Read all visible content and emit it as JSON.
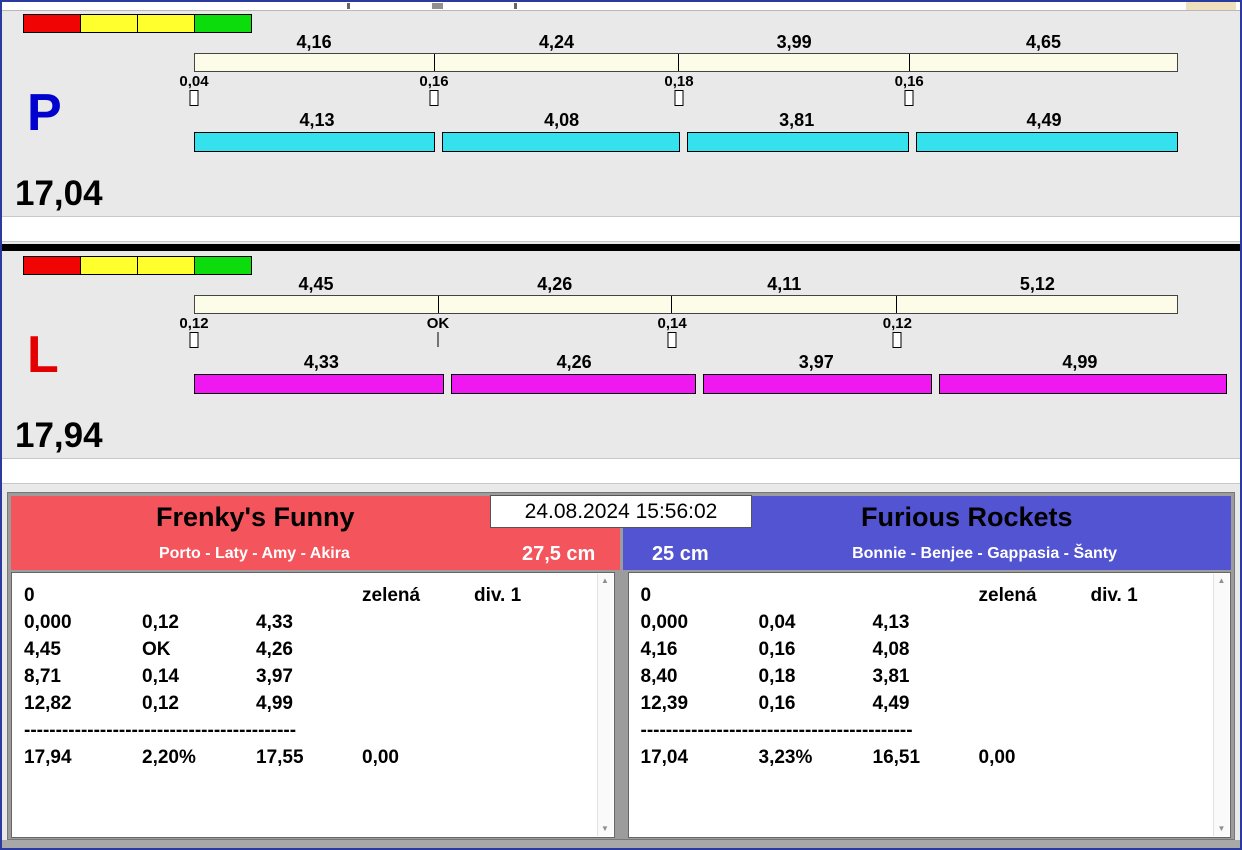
{
  "meta": {
    "timestamp": "24.08.2024 15:56:02"
  },
  "colors": {
    "gross_bar": "#fdfce8",
    "net_bar_right": "#35e1ec",
    "net_bar_left": "#f018f0",
    "left_team_header": "#f4545b",
    "right_team_header": "#5254d2",
    "lane_p_letter": "#0202cf",
    "lane_l_letter": "#e40000",
    "light_red": "#f00404",
    "light_yellow": "#ffff2e",
    "light_green": "#0cdc0c"
  },
  "lanes": [
    {
      "label": "P",
      "total": "17,04",
      "splits_gross": [
        "4,16",
        "4,24",
        "3,99",
        "4,65"
      ],
      "faults": [
        "0,04",
        "0,16",
        "0,18",
        "0,16"
      ],
      "splits_net": [
        "4,13",
        "4,08",
        "3,81",
        "4,49"
      ]
    },
    {
      "label": "L",
      "total": "17,94",
      "splits_gross": [
        "4,45",
        "4,26",
        "4,11",
        "5,12"
      ],
      "faults": [
        "0,12",
        "OK",
        "0,14",
        "0,12"
      ],
      "splits_net": [
        "4,33",
        "4,26",
        "3,97",
        "4,99"
      ]
    }
  ],
  "teams": [
    {
      "name": "Frenky's Funny",
      "dogs": "Porto - Laty - Amy - Akira",
      "jump_height": "27,5 cm",
      "info_row": {
        "c1": "0",
        "c4": "zelená",
        "c5": "div. 1"
      },
      "rows": [
        [
          "0,000",
          "0,12",
          "4,33"
        ],
        [
          "4,45",
          "OK",
          "4,26"
        ],
        [
          "8,71",
          "0,14",
          "3,97"
        ],
        [
          "12,82",
          "0,12",
          "4,99"
        ]
      ],
      "separator": "-------------------------------------------",
      "summary": [
        "17,94",
        "2,20%",
        "17,55",
        "0,00"
      ]
    },
    {
      "name": "Furious Rockets",
      "dogs": "Bonnie - Benjee - Gappasia - Šanty",
      "jump_height": "25 cm",
      "info_row": {
        "c1": "0",
        "c4": "zelená",
        "c5": "div. 1"
      },
      "rows": [
        [
          "0,000",
          "0,04",
          "4,13"
        ],
        [
          "4,16",
          "0,16",
          "4,08"
        ],
        [
          "8,40",
          "0,18",
          "3,81"
        ],
        [
          "12,39",
          "0,16",
          "4,49"
        ]
      ],
      "separator": "-------------------------------------------",
      "summary": [
        "17,04",
        "3,23%",
        "16,51",
        "0,00"
      ]
    }
  ]
}
